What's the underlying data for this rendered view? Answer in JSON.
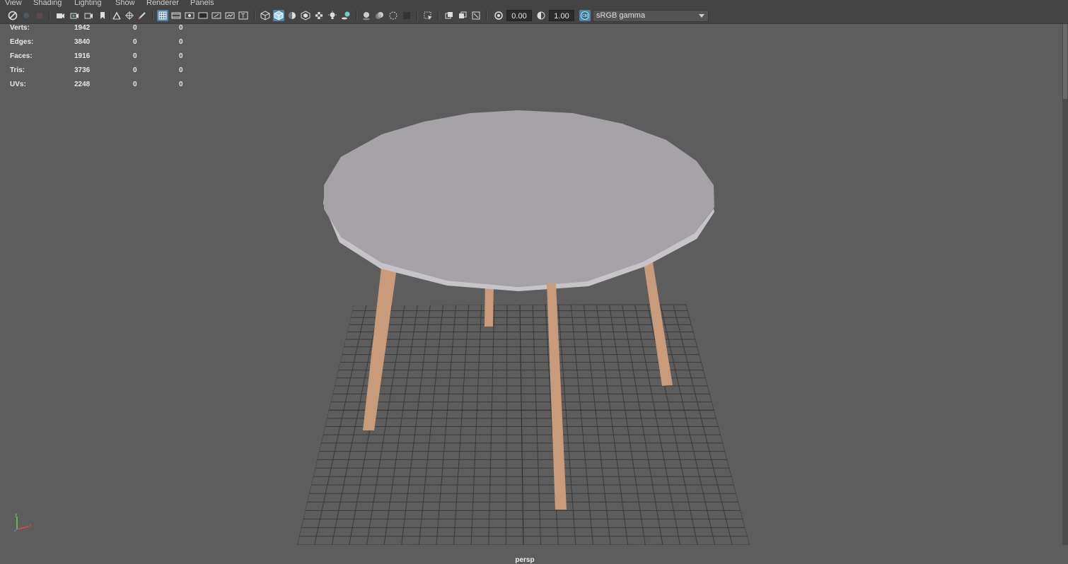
{
  "menu": {
    "items": [
      "View",
      "Shading",
      "Lighting",
      "Show",
      "Renderer",
      "Panels"
    ]
  },
  "toolbar": {
    "exposure_value": "0.00",
    "gamma_value": "1.00",
    "color_space": "sRGB gamma",
    "icons": [
      "select-camera-icon",
      "camera-attributes-icon",
      "bookmark-icon",
      "image-plane-icon",
      "2d-pan-zoom-icon",
      "grease-pencil-icon",
      "grid-icon",
      "film-gate-icon",
      "resolution-gate-icon",
      "gate-mask-icon",
      "field-chart-icon",
      "safe-action-icon",
      "safe-title-icon",
      "wireframe-icon",
      "smooth-shade-icon",
      "default-material-icon",
      "xray-icon",
      "textured-icon",
      "use-all-lights-icon",
      "shadows-icon",
      "screen-space-ao-icon",
      "motion-blur-icon",
      "anti-alias-icon",
      "depth-of-field-icon",
      "isolate-select-icon",
      "xray-joints-icon",
      "xray-active-icon",
      "backface-culling-icon",
      "exposure-icon",
      "gamma-icon",
      "color-management-icon"
    ],
    "accent_color": "#5285a6"
  },
  "hud": {
    "rows": [
      {
        "label": "Verts:",
        "total": "1942",
        "selected": "0",
        "triangles": "0"
      },
      {
        "label": "Edges:",
        "total": "3840",
        "selected": "0",
        "triangles": "0"
      },
      {
        "label": "Faces:",
        "total": "1916",
        "selected": "0",
        "triangles": "0"
      },
      {
        "label": "Tris:",
        "total": "3736",
        "selected": "0",
        "triangles": "0"
      },
      {
        "label": "UVs:",
        "total": "2248",
        "selected": "0",
        "triangles": "0"
      }
    ]
  },
  "viewport": {
    "camera_label": "persp",
    "background_color": "#5d5d5d",
    "tabletop_color": "#a5a2a8",
    "leg_color": "#c99b7a",
    "grid_color": "#3a3a3a"
  }
}
